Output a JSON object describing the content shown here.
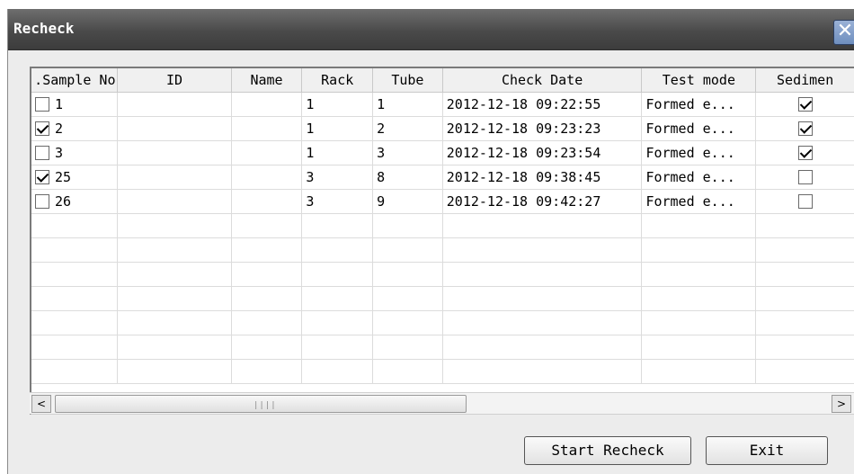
{
  "window": {
    "title": "Recheck",
    "close_label": "✕"
  },
  "table": {
    "columns": [
      "Sample No.",
      "ID",
      "Name",
      "Rack",
      "Tube",
      "Check Date",
      "Test mode",
      "Sedimen"
    ],
    "rows": [
      {
        "checked": false,
        "sample": "1",
        "id": "",
        "name": "",
        "rack": "1",
        "tube": "1",
        "date": "2012-12-18 09:22:55",
        "mode": "Formed e...",
        "sediment": true
      },
      {
        "checked": true,
        "sample": "2",
        "id": "",
        "name": "",
        "rack": "1",
        "tube": "2",
        "date": "2012-12-18 09:23:23",
        "mode": "Formed e...",
        "sediment": true
      },
      {
        "checked": false,
        "sample": "3",
        "id": "",
        "name": "",
        "rack": "1",
        "tube": "3",
        "date": "2012-12-18 09:23:54",
        "mode": "Formed e...",
        "sediment": true
      },
      {
        "checked": true,
        "sample": "25",
        "id": "",
        "name": "",
        "rack": "3",
        "tube": "8",
        "date": "2012-12-18 09:38:45",
        "mode": "Formed e...",
        "sediment": false
      },
      {
        "checked": false,
        "sample": "26",
        "id": "",
        "name": "",
        "rack": "3",
        "tube": "9",
        "date": "2012-12-18 09:42:27",
        "mode": "Formed e...",
        "sediment": false
      }
    ],
    "empty_rows": 7
  },
  "scrollbar": {
    "left_arrow": "<",
    "right_arrow": ">"
  },
  "buttons": {
    "start_recheck": "Start Recheck",
    "exit": "Exit"
  }
}
